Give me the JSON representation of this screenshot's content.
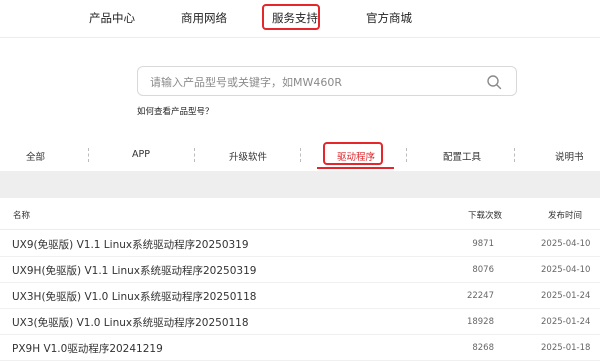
{
  "nav": {
    "items": [
      "产品中心",
      "商用网络",
      "服务支持",
      "官方商城"
    ],
    "active_index": 2
  },
  "search": {
    "placeholder": "请输入产品型号或关键字，如MW460R",
    "value": "",
    "icon": "search-icon",
    "howto_link": "如何查看产品型号？"
  },
  "tabs": {
    "items": [
      "全部",
      "APP",
      "升级软件",
      "驱动程序",
      "配置工具",
      "说明书"
    ],
    "active_index": 3
  },
  "table": {
    "headers": [
      "名称",
      "下载次数",
      "发布时间"
    ],
    "rows": [
      {
        "name": "UX9(免驱版) V1.1 Linux系统驱动程序20250319",
        "count": "9871",
        "date": "2025-04-10"
      },
      {
        "name": "UX9H(免驱版) V1.1 Linux系统驱动程序20250319",
        "count": "8076",
        "date": "2025-04-10"
      },
      {
        "name": "UX3H(免驱版) V1.0 Linux系统驱动程序20250118",
        "count": "22247",
        "date": "2025-01-24"
      },
      {
        "name": "UX3(免驱版) V1.0 Linux系统驱动程序20250118",
        "count": "18928",
        "date": "2025-01-24"
      },
      {
        "name": "PX9H V1.0驱动程序20241219",
        "count": "8268",
        "date": "2025-01-18"
      }
    ]
  },
  "colors": {
    "accent": "#e5262b",
    "band": "#eeeeee"
  }
}
